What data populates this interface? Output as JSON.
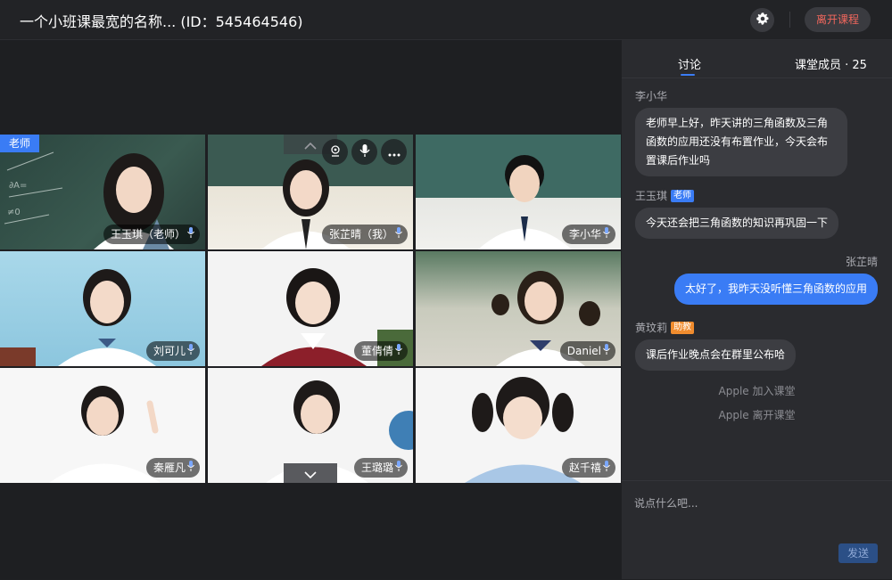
{
  "header": {
    "title": "一个小班课最宽的名称... (ID：545464546)",
    "leave_label": "离开课程",
    "settings_icon": "gear-icon"
  },
  "colors": {
    "accent": "#3a7cf5",
    "danger": "#f2675d",
    "assistant_badge": "#f08c2e"
  },
  "stage": {
    "teacher_badge": "老师",
    "participants": [
      {
        "name": "王玉琪（老师）",
        "mic": "mic-icon",
        "bg": "#2f4a42",
        "role": "teacher"
      },
      {
        "name": "张芷晴（我）",
        "mic": "mic-icon",
        "bg": "#e8e3d6",
        "role": "self"
      },
      {
        "name": "李小华",
        "mic": "mic-icon",
        "bg": "#cfd8d3",
        "role": "student"
      },
      {
        "name": "刘可儿",
        "mic": "mic-icon",
        "bg": "#9fd0e6",
        "role": "student"
      },
      {
        "name": "董倩倩",
        "mic": "mic-icon",
        "bg": "#f3f3f3",
        "role": "student"
      },
      {
        "name": "Daniel",
        "mic": "mic-icon",
        "bg": "#cfd2c6",
        "role": "student"
      },
      {
        "name": "秦雁凡",
        "mic": "mic-icon",
        "bg": "#f7f7f7",
        "role": "student"
      },
      {
        "name": "王璐璐",
        "mic": "mic-icon",
        "bg": "#f2f2f2",
        "role": "student"
      },
      {
        "name": "赵千禧",
        "mic": "mic-icon",
        "bg": "#f4f4f4",
        "role": "student"
      }
    ],
    "tile_controls": [
      "camera-icon",
      "microphone-icon",
      "more-icon"
    ]
  },
  "panel": {
    "tabs": [
      {
        "label": "讨论",
        "active": true
      },
      {
        "label": "课堂成员 · 25",
        "active": false
      }
    ],
    "messages": [
      {
        "sender": "李小华",
        "role": "",
        "text_lines": [
          "老师早上好，昨天讲的三角函数及三角",
          "函数的应用还没有布置作业，今天会布",
          "置课后作业吗"
        ],
        "self": false
      },
      {
        "sender": "王玉琪",
        "role": "老师",
        "text_lines": [
          "今天还会把三角函数的知识再巩固一下"
        ],
        "self": false
      },
      {
        "sender": "张芷晴",
        "role": "",
        "text_lines": [
          "太好了，我昨天没听懂三角函数的应用"
        ],
        "self": true
      },
      {
        "sender": "黄玟莉",
        "role": "助教",
        "text_lines": [
          "课后作业晚点会在群里公布哈"
        ],
        "self": false
      }
    ],
    "system_messages": [
      "Apple 加入课堂",
      "Apple 离开课堂"
    ],
    "input_placeholder": "说点什么吧...",
    "send_label": "发送"
  }
}
